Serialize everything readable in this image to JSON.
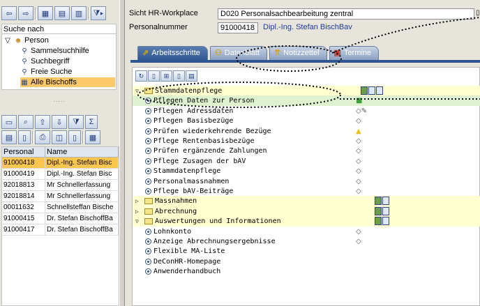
{
  "left": {
    "search_heading": "Suche nach",
    "tree": [
      {
        "label": "Person",
        "level": 0,
        "icon": "person-icon",
        "expanded": true
      },
      {
        "label": "Sammelsuchhilfe",
        "level": 1,
        "icon": "binoculars-icon"
      },
      {
        "label": "Suchbegriff",
        "level": 1,
        "icon": "binoculars-icon"
      },
      {
        "label": "Freie Suche",
        "level": 1,
        "icon": "binoculars-icon"
      },
      {
        "label": "Alle Bischoffs",
        "level": 1,
        "icon": "table-icon",
        "selected": true
      }
    ],
    "grid": {
      "columns": [
        "Personal",
        "Name"
      ],
      "rows": [
        {
          "id": "91000418",
          "name": "Dipl.-Ing. Stefan Bisc",
          "selected": true
        },
        {
          "id": "91000419",
          "name": "Dipl.-Ing. Stefan Bisc"
        },
        {
          "id": "92018813",
          "name": "Mr Schnellerfassung"
        },
        {
          "id": "92018814",
          "name": "Mr Schnellerfassung"
        },
        {
          "id": "00011632",
          "name": "Schnellsteffan Bische"
        },
        {
          "id": "91000415",
          "name": "Dr. Stefan BischoffBa"
        },
        {
          "id": "91000417",
          "name": "Dr. Stefan BischoffBa"
        }
      ]
    }
  },
  "right": {
    "sicht_label": "Sicht HR-Workplace",
    "sicht_value": "D020 Personalsachbearbeitung zentral",
    "pnr_label": "Personalnummer",
    "pnr_value": "91000418",
    "pnr_name": "Dipl.-Ing. Stefan BischBav",
    "tabs": [
      "Arbeitsschritte",
      "Datenblatt",
      "Notizzettel",
      "Termine"
    ],
    "tree": [
      {
        "label": "Stammdatenpflege",
        "type": "folder",
        "expanded": true,
        "docs": 3
      },
      {
        "label": "Pflegen Daten zur Person",
        "type": "item",
        "highlight": true,
        "status": "green"
      },
      {
        "label": "Pflegen Adressdaten",
        "type": "item",
        "status": "diamond-edit"
      },
      {
        "label": "Pflegen Basisbezüge",
        "type": "item",
        "status": "diamond"
      },
      {
        "label": "Prüfen wiederkehrende Bezüge",
        "type": "item",
        "status": "warning"
      },
      {
        "label": "Pflege Rentenbasisbezüge",
        "type": "item",
        "status": "diamond"
      },
      {
        "label": "Prüfen ergänzende Zahlungen",
        "type": "item",
        "status": "diamond"
      },
      {
        "label": "Pflege Zusagen der bAV",
        "type": "item",
        "status": "diamond"
      },
      {
        "label": "Stammdatenpflege",
        "type": "item",
        "status": "diamond"
      },
      {
        "label": "Personalmassnahmen",
        "type": "item",
        "status": "diamond"
      },
      {
        "label": "Pflege bAV-Beiträge",
        "type": "item",
        "status": "diamond"
      },
      {
        "label": "Massnahmen",
        "type": "folder",
        "expanded": false,
        "docs": 2
      },
      {
        "label": "Abrechnung",
        "type": "folder",
        "expanded": false,
        "docs": 2
      },
      {
        "label": "Auswertungen und Informationen",
        "type": "folder",
        "expanded": true,
        "docs": 2
      },
      {
        "label": "Lohnkonto",
        "type": "item",
        "status": "diamond"
      },
      {
        "label": "Anzeige Abrechnungsergebnisse",
        "type": "item",
        "status": "diamond"
      },
      {
        "label": "Flexible MA-Liste",
        "type": "item"
      },
      {
        "label": "DeConHR-Homepage",
        "type": "item"
      },
      {
        "label": "Anwenderhandbuch",
        "type": "item"
      }
    ]
  },
  "colors": {
    "selected": "#fbc64e",
    "folder_bg": "#ffffd0",
    "highlight": "#dff2cf",
    "tab_active": "#2f5690"
  }
}
